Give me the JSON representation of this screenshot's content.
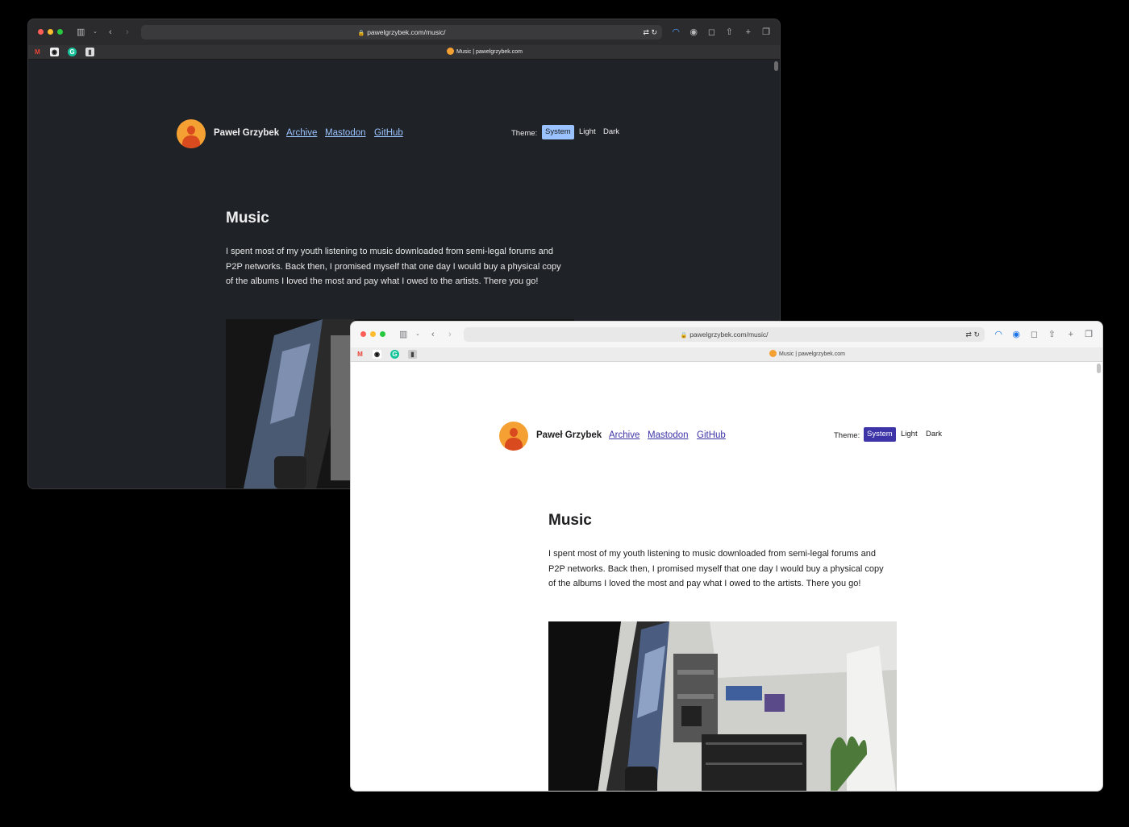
{
  "browser": {
    "url": "pawelgrzybek.com/music/",
    "tab_title": "Music | pawelgrzybek.com"
  },
  "site": {
    "author_name": "Paweł Grzybek",
    "nav": [
      {
        "label": "Archive"
      },
      {
        "label": "Mastodon"
      },
      {
        "label": "GitHub"
      }
    ],
    "theme_label": "Theme:",
    "theme_options": [
      {
        "label": "System",
        "active": true
      },
      {
        "label": "Light",
        "active": false
      },
      {
        "label": "Dark",
        "active": false
      }
    ]
  },
  "page": {
    "title": "Music",
    "intro": "I spent most of my youth listening to music downloaded from semi-legal forums and P2P networks. Back then, I promised myself that one day I would buy a physical copy of the albums I loved the most and pay what I owed to the artists. There you go!"
  },
  "icons": [
    "sidebar-icon",
    "chevron-down-icon",
    "back-icon",
    "forward-icon",
    "reader-icon",
    "lock-icon",
    "translate-icon",
    "reload-icon",
    "rss-icon",
    "extension-icon",
    "chat-icon",
    "share-icon",
    "new-tab-icon",
    "tabs-overview-icon",
    "gmail-icon",
    "github-icon",
    "grammarly-icon",
    "bookmark-icon"
  ],
  "colors": {
    "dark_bg": "#1f2227",
    "dark_accent": "#9ac2ff",
    "light_bg": "#ffffff",
    "light_accent": "#3d34a8",
    "avatar": "#f5a033"
  }
}
